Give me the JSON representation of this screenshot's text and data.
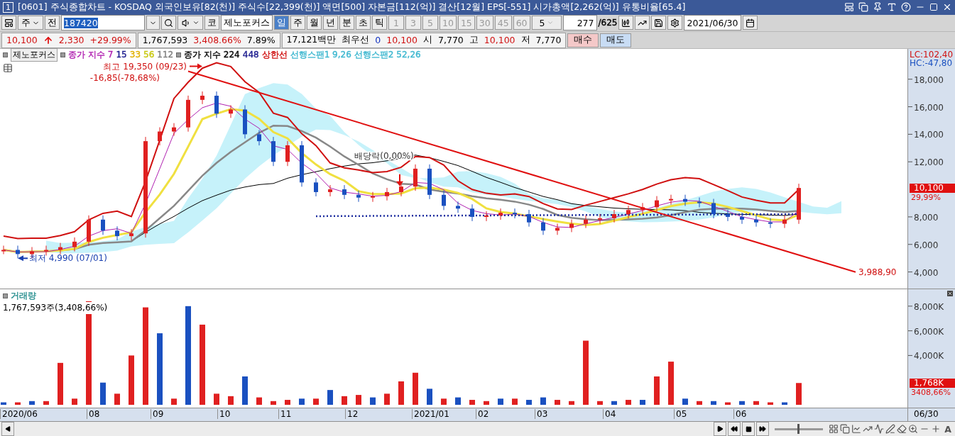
{
  "window": {
    "number": "1",
    "title": "[0601] 주식종합차트 - KOSDAQ 외국인보유[82(천)] 주식수[22,399(천)] 액면[500] 자본금[112(억)] 결산[12월] EPS[-551] 시가총액[2,262(억)] 유통비율[65.4]"
  },
  "toolbar": {
    "market": "주",
    "prev_label": "전",
    "code": "187420",
    "code_prefix": "코",
    "name": "제노포커스",
    "periods": [
      {
        "label": "일",
        "selected": true
      },
      {
        "label": "주",
        "selected": false
      },
      {
        "label": "월",
        "selected": false
      },
      {
        "label": "년",
        "selected": false
      },
      {
        "label": "분",
        "selected": false
      },
      {
        "label": "초",
        "selected": false
      },
      {
        "label": "틱",
        "selected": false
      }
    ],
    "intervals": [
      {
        "label": "1",
        "disabled": true
      },
      {
        "label": "3",
        "disabled": true
      },
      {
        "label": "5",
        "disabled": true
      },
      {
        "label": "10",
        "disabled": true
      },
      {
        "label": "15",
        "disabled": true
      },
      {
        "label": "30",
        "disabled": true
      },
      {
        "label": "45",
        "disabled": true
      },
      {
        "label": "60",
        "disabled": true
      }
    ],
    "interval_value": "5",
    "count": "277",
    "total": "/625",
    "date": "2021/06/30"
  },
  "quote": {
    "rising": true,
    "boxes": [
      [
        {
          "text": "10,100",
          "color": "#d01010"
        },
        {
          "text": "2,330",
          "color": "#d01010"
        },
        {
          "text": "+29.99%",
          "color": "#d01010"
        }
      ],
      [
        {
          "text": "1,767,593"
        },
        {
          "text": "3,408.66%",
          "color": "#d01010"
        },
        {
          "text": "7.89%"
        }
      ],
      [
        {
          "text": "17,121백만"
        },
        {
          "text": "최우선"
        },
        {
          "text": "0",
          "color": "#1030c0"
        },
        {
          "text": "10,100",
          "color": "#d01010"
        },
        {
          "text": "시"
        },
        {
          "text": "7,770"
        },
        {
          "text": "고"
        },
        {
          "text": "10,100",
          "color": "#d01010"
        },
        {
          "text": "저"
        },
        {
          "text": "7,770"
        }
      ]
    ],
    "buy": "매수",
    "sell": "매도"
  },
  "legend": [
    {
      "label": "제노포커스",
      "kind": "button"
    },
    {
      "kind": "group",
      "items": [
        {
          "text": "종가 지수",
          "color": "#b020b0"
        },
        {
          "text": "7",
          "color": "#b020b0"
        },
        {
          "text": "15",
          "color": "#202090"
        },
        {
          "text": "33",
          "color": "#e0b000"
        },
        {
          "text": "56",
          "color": "#c8c810"
        },
        {
          "text": "112",
          "color": "#808080"
        }
      ]
    },
    {
      "kind": "group",
      "items": [
        {
          "text": "종가 지수 224"
        },
        {
          "text": "448",
          "color": "#202090"
        },
        {
          "text": "상한선",
          "color": "#d01010"
        },
        {
          "text": "선행스팬1 9,26",
          "color": "#40b8d0"
        },
        {
          "text": "선행스팬2 52,26",
          "color": "#40b8d0"
        }
      ]
    }
  ],
  "price_chart": {
    "lc": "LC:102,40",
    "hc": "HC:-47,80",
    "last_price": "10,100",
    "last_change": "29,99%",
    "y_axis": [
      "18,000",
      "16,000",
      "14,000",
      "12,000",
      "8,000",
      "6,000",
      "4,000"
    ],
    "annotations": [
      "최고 19,350 (09/23)",
      "-16,85(-78,68%)",
      "최저 4,990 (07/01)",
      "배당락(0,00%)",
      "3,988,90"
    ]
  },
  "volume_chart": {
    "title": "거래량",
    "reading": "1,767,593주(3,408,66%)",
    "last_value": "1,768K",
    "last_change": "3408,66%",
    "y_axis": [
      "8,000K",
      "6,000K",
      "4,000K"
    ]
  },
  "x_axis": [
    "2020/06",
    "08",
    "09",
    "10",
    "11",
    "12",
    "2021/01",
    "02",
    "03",
    "04",
    "05",
    "06"
  ],
  "x_axis_end": "06/30",
  "bottom_toolbar": {
    "zoom": {
      "level": 0.48
    },
    "font_button": "A"
  }
}
